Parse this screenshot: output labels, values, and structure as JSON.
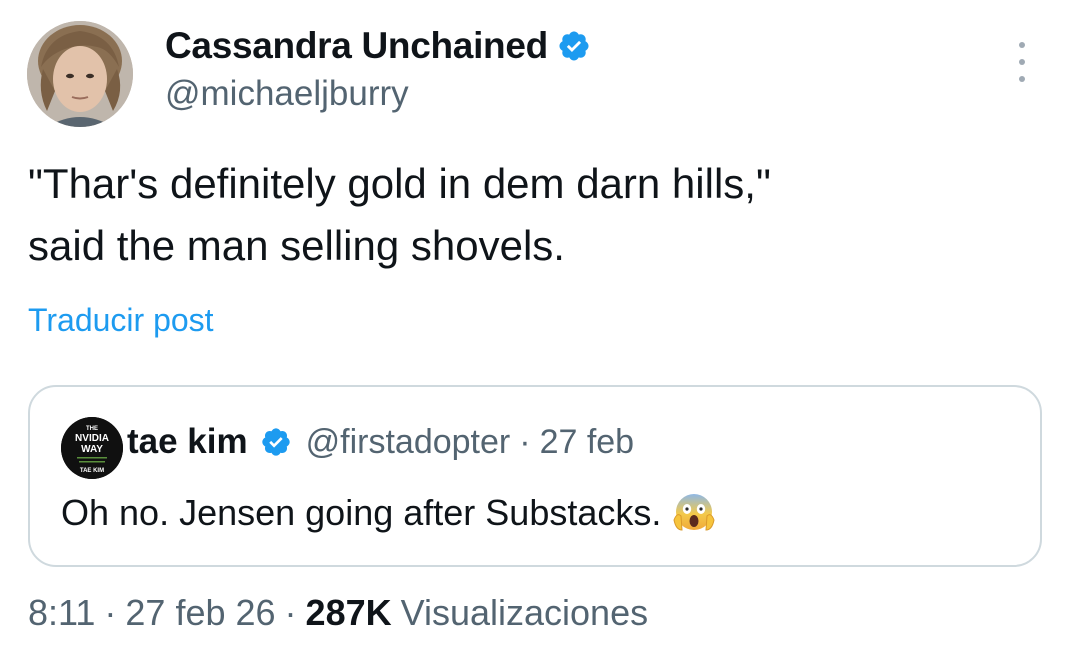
{
  "author": {
    "display_name": "Cassandra Unchained",
    "handle": "@michaeljburry",
    "verified": true
  },
  "tweet": {
    "lines": [
      "\"Thar's definitely gold in dem darn hills,\"",
      "said the man selling shovels."
    ],
    "translate_label": "Traducir post"
  },
  "quote": {
    "avatar_text": {
      "line1": "THE",
      "line2": "NVIDIA",
      "line3": "WAY",
      "line4": "TAE KIM"
    },
    "display_name": "tae kim",
    "handle": "@firstadopter",
    "separator": "·",
    "date": "27 feb",
    "text": "Oh no. Jensen going after Substacks.",
    "emoji": "face-screaming-in-fear-emoji"
  },
  "meta": {
    "time": "8:11",
    "separator": "·",
    "date": "27 feb 26",
    "views_count": "287K",
    "views_label": "Visualizaciones"
  },
  "colors": {
    "accent": "#1d9bf0",
    "secondary_text": "#536471",
    "border": "#cfd9de"
  },
  "icons": {
    "verified": "verified-badge-icon",
    "more": "more-options-icon"
  }
}
